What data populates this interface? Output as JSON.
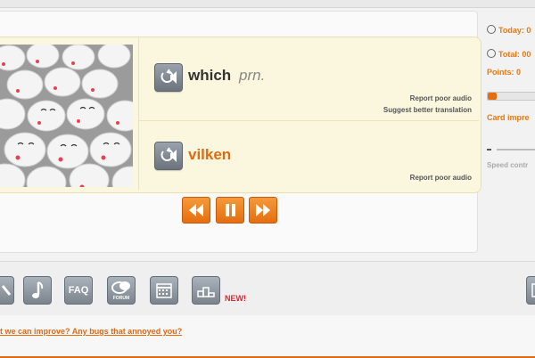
{
  "card": {
    "source_word": "which",
    "source_pos": "prn.",
    "report_audio_label": "Report poor audio",
    "suggest_translation_label": "Suggest better translation",
    "target_word": "vilken",
    "target_report_audio_label": "Report poor audio"
  },
  "controls": {
    "rewind_icon": "rewind-icon",
    "pause_icon": "pause-icon",
    "forward_icon": "fast-forward-icon"
  },
  "stats": {
    "today_label": "Today: 0",
    "total_label": "Total: 00",
    "points_label": "Points: 0",
    "card_improve_label": "Card impre",
    "speed_label": "Speed contr"
  },
  "toolbar": {
    "faq_label": "FAQ",
    "forum_label": "FORUM",
    "new_badge": "NEW!"
  },
  "footer": {
    "feedback_link": "t we can improve? Any bugs that annoyed you?"
  },
  "colors": {
    "accent": "#e06a12",
    "card_bg": "#fbf7df"
  }
}
